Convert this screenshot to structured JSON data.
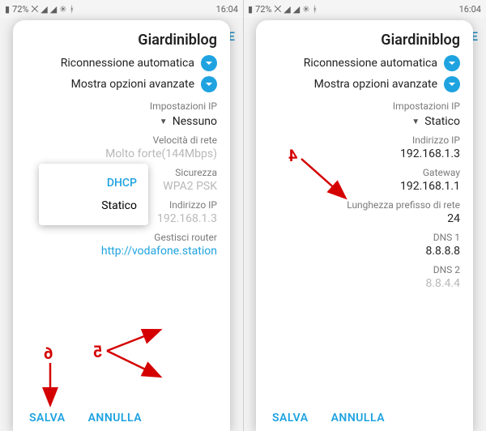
{
  "status": {
    "time": "16:04",
    "battery_pct": "72%",
    "icons": [
      "bt-icon",
      "vibrate-icon",
      "net1-icon",
      "net2-icon",
      "wifi-icon",
      "battery-icon"
    ]
  },
  "bg": {
    "tab_truncated": "TE"
  },
  "common": {
    "network_name": "Giardiniblog",
    "auto_reconnect": "Riconnessione automatica",
    "show_advanced": "Mostra opzioni avanzate",
    "ip_settings_header": "Impostazioni IP",
    "footer": {
      "cancel": "ANNULLA",
      "save": "SALVA"
    }
  },
  "left": {
    "ip_mode_behind": "Nessuno",
    "ip_dropdown": {
      "dhcp": "DHCP",
      "static": "Statico"
    },
    "speed_label": "Velocità di rete",
    "speed_value": "Molto forte(144Mbps)",
    "security_label": "Sicurezza",
    "security_value": "WPA2 PSK",
    "ip_label": "Indirizzo IP",
    "ip_value": "192.168.1.3",
    "manage_router_label": "Gestisci router",
    "manage_router_value": "http://vodafone.station"
  },
  "right": {
    "ip_mode": "Statico",
    "ip_label": "Indirizzo IP",
    "ip_value": "192.168.1.3",
    "gateway_label": "Gateway",
    "gateway_value": "192.168.1.1",
    "prefix_label": "Lunghezza prefisso di rete",
    "prefix_value": "24",
    "dns1_label": "DNS 1",
    "dns1_value": "8.8.8.8",
    "dns2_label": "DNS 2",
    "dns2_value": "8.8.4.4"
  },
  "annotations": {
    "n4": "4",
    "n5": "5",
    "n6": "6"
  }
}
